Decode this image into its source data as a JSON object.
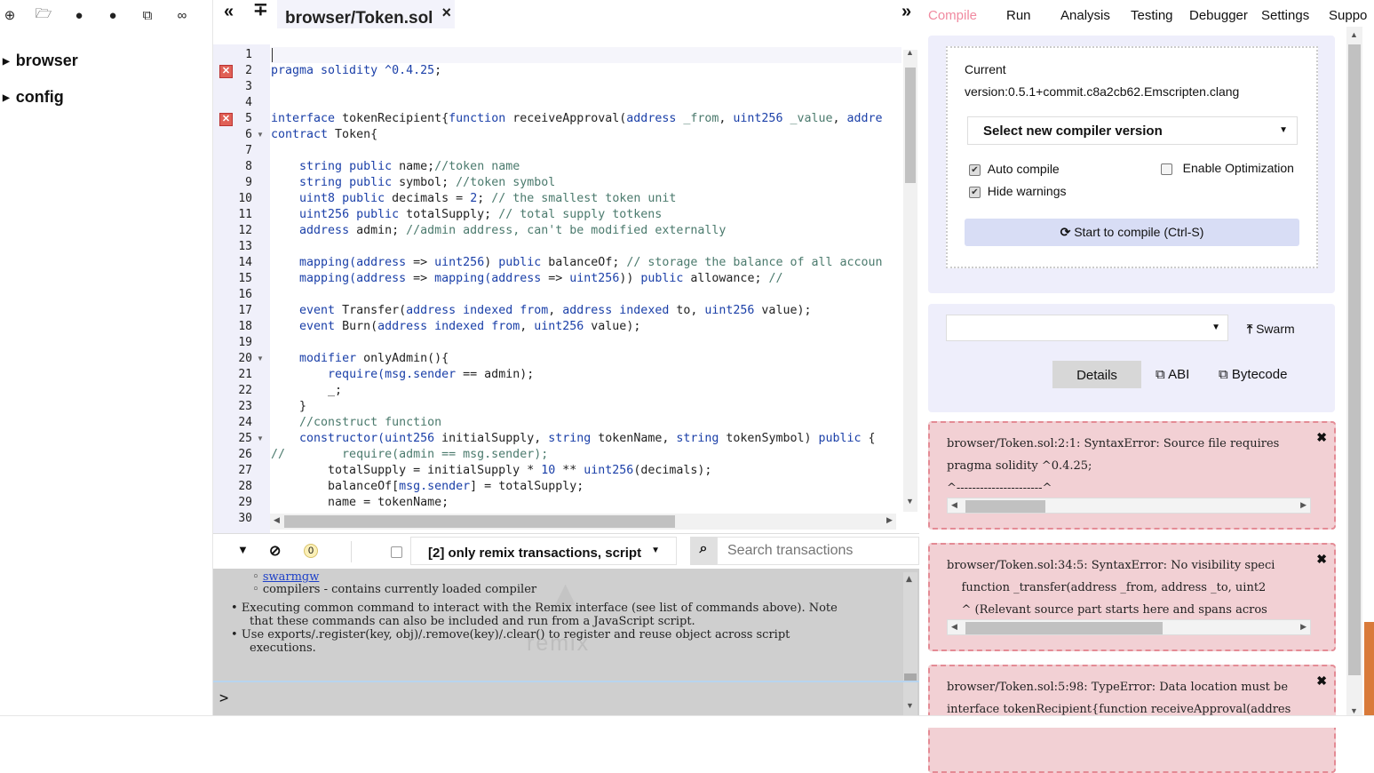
{
  "file_panel": {
    "icons": [
      "plus-icon",
      "folder-open-icon",
      "github-icon",
      "github-icon",
      "copy-icon",
      "link-icon"
    ],
    "tree": [
      "browser",
      "config"
    ]
  },
  "tabs": {
    "active_file": "browser/Token.sol",
    "close": "×",
    "collapse_left": "«",
    "expand": "»"
  },
  "editor": {
    "line_numbers": [
      "1",
      "2",
      "3",
      "4",
      "5",
      "6",
      "7",
      "8",
      "9",
      "10",
      "11",
      "12",
      "13",
      "14",
      "15",
      "16",
      "17",
      "18",
      "19",
      "20",
      "21",
      "22",
      "23",
      "24",
      "25",
      "26",
      "27",
      "28",
      "29",
      "30"
    ],
    "error_lines": [
      2,
      5
    ],
    "fold_lines": [
      6,
      20,
      25
    ],
    "code": [
      [],
      [
        [
          "kw",
          "pragma solidity ^0.4.25"
        ],
        [
          "",
          "; "
        ]
      ],
      [],
      [],
      [
        [
          "kw",
          "interface"
        ],
        [
          "",
          " tokenRecipient{"
        ],
        [
          "kw",
          "function"
        ],
        [
          "",
          " receiveApproval("
        ],
        [
          "kw",
          "address"
        ],
        [
          "cm",
          " _from"
        ],
        [
          "",
          ", "
        ],
        [
          "kw",
          "uint256"
        ],
        [
          "cm",
          " _value"
        ],
        [
          "",
          ", "
        ],
        [
          "kw",
          "addre"
        ]
      ],
      [
        [
          "kw",
          "contract"
        ],
        [
          "",
          " Token{"
        ]
      ],
      [],
      [
        [
          "",
          "    "
        ],
        [
          "kw",
          "string public"
        ],
        [
          "",
          " name;"
        ],
        [
          "cm",
          "//token name"
        ]
      ],
      [
        [
          "",
          "    "
        ],
        [
          "kw",
          "string public"
        ],
        [
          "",
          " symbol; "
        ],
        [
          "cm",
          "//token symbol"
        ]
      ],
      [
        [
          "",
          "    "
        ],
        [
          "kw",
          "uint8 public"
        ],
        [
          "",
          " decimals = "
        ],
        [
          "nu",
          "2"
        ],
        [
          "",
          ";"
        ],
        [
          "cm",
          " // the smallest token unit"
        ]
      ],
      [
        [
          "",
          "    "
        ],
        [
          "kw",
          "uint256 public"
        ],
        [
          "",
          " totalSupply; "
        ],
        [
          "cm",
          "// total supply totkens"
        ]
      ],
      [
        [
          "",
          "    "
        ],
        [
          "kw",
          "address"
        ],
        [
          "",
          " admin; "
        ],
        [
          "cm",
          "//admin address, can't be modified externally"
        ]
      ],
      [],
      [
        [
          "",
          "    "
        ],
        [
          "kw",
          "mapping(address"
        ],
        [
          "",
          " => "
        ],
        [
          "kw",
          "uint256"
        ],
        [
          "",
          ") "
        ],
        [
          "kw",
          "public"
        ],
        [
          "",
          " balanceOf; "
        ],
        [
          "cm",
          "// storage the balance of all accoun"
        ]
      ],
      [
        [
          "",
          "    "
        ],
        [
          "kw",
          "mapping(address"
        ],
        [
          "",
          " => "
        ],
        [
          "kw",
          "mapping(address"
        ],
        [
          "",
          " => "
        ],
        [
          "kw",
          "uint256"
        ],
        [
          "",
          "))"
        ],
        [
          "kw",
          " public"
        ],
        [
          "",
          " allowance; "
        ],
        [
          "cm",
          "//"
        ]
      ],
      [],
      [
        [
          "",
          "    "
        ],
        [
          "kw",
          "event"
        ],
        [
          "",
          " Transfer("
        ],
        [
          "kw",
          "address indexed from"
        ],
        [
          "",
          ", "
        ],
        [
          "kw",
          "address indexed"
        ],
        [
          "",
          " to, "
        ],
        [
          "kw",
          "uint256"
        ],
        [
          "",
          " value);"
        ]
      ],
      [
        [
          "",
          "    "
        ],
        [
          "kw",
          "event"
        ],
        [
          "",
          " Burn("
        ],
        [
          "kw",
          "address indexed from"
        ],
        [
          "",
          ", "
        ],
        [
          "kw",
          "uint256"
        ],
        [
          "",
          " value);"
        ]
      ],
      [],
      [
        [
          "",
          "    "
        ],
        [
          "kw",
          "modifier"
        ],
        [
          "",
          " onlyAdmin(){"
        ]
      ],
      [
        [
          "",
          "        "
        ],
        [
          "kw",
          "require(msg.sender"
        ],
        [
          "",
          " == admin);"
        ]
      ],
      [
        [
          "",
          "        _;"
        ]
      ],
      [
        [
          "",
          "    }"
        ]
      ],
      [
        [
          "",
          "    "
        ],
        [
          "cm",
          "//construct function"
        ]
      ],
      [
        [
          "",
          "    "
        ],
        [
          "kw",
          "constructor(uint256"
        ],
        [
          "",
          " initialSupply, "
        ],
        [
          "kw",
          "string"
        ],
        [
          "",
          " tokenName, "
        ],
        [
          "kw",
          "string"
        ],
        [
          "",
          " tokenSymbol) "
        ],
        [
          "kw",
          "public"
        ],
        [
          "",
          " {"
        ]
      ],
      [
        [
          "cm",
          "//        require(admin == msg.sender);"
        ]
      ],
      [
        [
          "",
          "        totalSupply = initialSupply * "
        ],
        [
          "nu",
          "10"
        ],
        [
          "",
          " ** "
        ],
        [
          "kw",
          "uint256"
        ],
        [
          "",
          "(decimals);"
        ]
      ],
      [
        [
          "",
          "        balanceOf["
        ],
        [
          "kw",
          "msg.sender"
        ],
        [
          "",
          "] = totalSupply;"
        ]
      ],
      [
        [
          "",
          "        name = tokenName;"
        ]
      ]
    ]
  },
  "terminal_bar": {
    "filter_label": "[2] only remix transactions, script",
    "counter": "0",
    "search_placeholder": "Search transactions"
  },
  "terminal": {
    "lines": [
      [
        "link",
        "swarmgw"
      ],
      [
        "sub",
        "compilers - contains currently loaded compiler"
      ],
      [
        "bul",
        "Executing common command to interact with the Remix interface (see list of commands above). Note"
      ],
      [
        "cont",
        "that these commands can also be included and run from a JavaScript script."
      ],
      [
        "bul",
        "Use exports/.register(key, obj)/.remove(key)/.clear() to register and reuse object across script"
      ],
      [
        "cont",
        "executions."
      ]
    ],
    "watermark": "remix",
    "prompt": ">"
  },
  "right_tabs": [
    "Compile",
    "Run",
    "Analysis",
    "Testing",
    "Debugger",
    "Settings",
    "Suppo"
  ],
  "compile": {
    "current_label": "Current",
    "version": "version:0.5.1+commit.c8a2cb62.Emscripten.clang",
    "select_version": "Select new compiler version",
    "auto_compile": "Auto compile",
    "enable_optimization": "Enable Optimization",
    "hide_warnings": "Hide warnings",
    "compile_button": "Start to compile (Ctrl-S)"
  },
  "contract": {
    "selected": "",
    "swarm": "Swarm",
    "details": "Details",
    "abi": "ABI",
    "bytecode": "Bytecode"
  },
  "messages": [
    [
      "browser/Token.sol:2:1: SyntaxError: Source file requires",
      "pragma solidity ^0.4.25;",
      "^----------------------^"
    ],
    [
      "browser/Token.sol:34:5: SyntaxError: No visibility speci",
      "    function _transfer(address _from, address _to, uint2",
      "    ^ (Relevant source part starts here and spans acros"
    ],
    [
      "browser/Token.sol:5:98: TypeError: Data location must be",
      "interface tokenRecipient{function receiveApproval(addres",
      ""
    ]
  ],
  "colors": {
    "accent": "#f08aa0",
    "error_bg": "#f2d0d4",
    "panel": "#eeeefb"
  }
}
